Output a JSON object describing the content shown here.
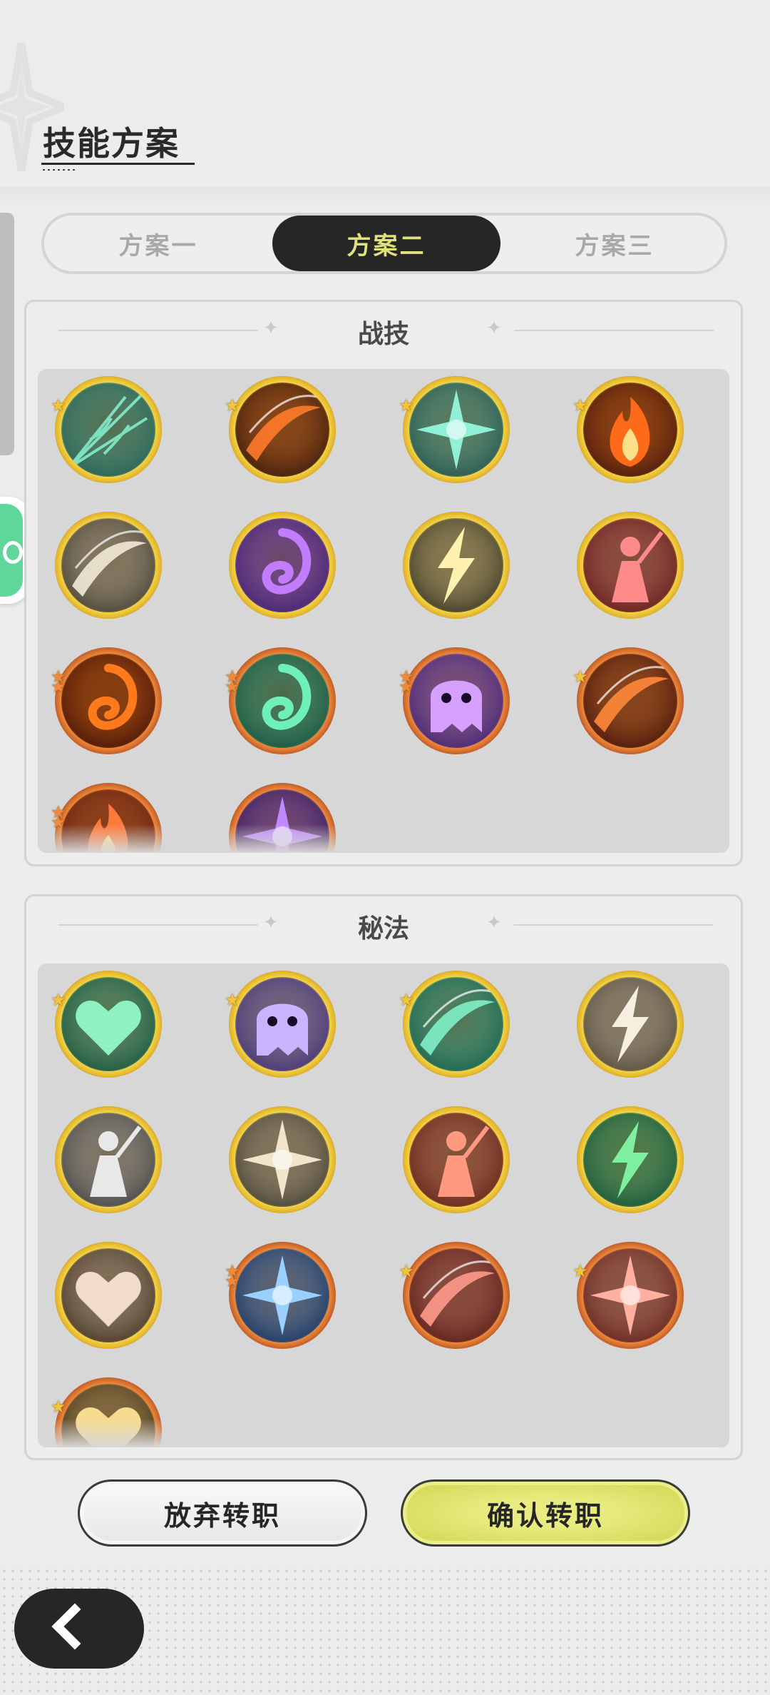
{
  "page": {
    "title": "技能方案"
  },
  "tabs": [
    {
      "label": "方案一",
      "active": false
    },
    {
      "label": "方案二",
      "active": true
    },
    {
      "label": "方案三",
      "active": false
    }
  ],
  "sections": [
    {
      "title": "战技",
      "skills": [
        {
          "icon": "spider-web-icon",
          "stars": 1,
          "tier": "gold"
        },
        {
          "icon": "fire-slash-icon",
          "stars": 1,
          "tier": "gold"
        },
        {
          "icon": "sword-burst-icon",
          "stars": 1,
          "tier": "gold"
        },
        {
          "icon": "flame-ring-icon",
          "stars": 1,
          "tier": "gold"
        },
        {
          "icon": "wind-slash-icon",
          "stars": 0,
          "tier": "gold"
        },
        {
          "icon": "purple-vortex-icon",
          "stars": 0,
          "tier": "gold"
        },
        {
          "icon": "lightning-strike-icon",
          "stars": 0,
          "tier": "gold"
        },
        {
          "icon": "warrior-blade-icon",
          "stars": 0,
          "tier": "gold"
        },
        {
          "icon": "fire-swirl-icon",
          "stars": 2,
          "tier": "orange"
        },
        {
          "icon": "green-tornado-icon",
          "stars": 2,
          "tier": "orange"
        },
        {
          "icon": "ghost-face-icon",
          "stars": 2,
          "tier": "orange"
        },
        {
          "icon": "flame-wave-icon",
          "stars": 1,
          "tier": "orange"
        },
        {
          "icon": "fire-figure-icon",
          "stars": 2,
          "tier": "orange"
        },
        {
          "icon": "purple-bloom-icon",
          "stars": 0,
          "tier": "orange"
        }
      ]
    },
    {
      "title": "秘法",
      "skills": [
        {
          "icon": "heal-heart-icon",
          "stars": 1,
          "tier": "gold"
        },
        {
          "icon": "shadow-beast-icon",
          "stars": 1,
          "tier": "gold"
        },
        {
          "icon": "green-blade-icon",
          "stars": 1,
          "tier": "gold"
        },
        {
          "icon": "crystal-shard-icon",
          "stars": 0,
          "tier": "gold"
        },
        {
          "icon": "dancing-figure-icon",
          "stars": 0,
          "tier": "gold"
        },
        {
          "icon": "leaf-emblem-icon",
          "stars": 0,
          "tier": "gold"
        },
        {
          "icon": "red-armor-icon",
          "stars": 0,
          "tier": "gold"
        },
        {
          "icon": "green-gem-icon",
          "stars": 0,
          "tier": "gold"
        },
        {
          "icon": "heart-shield-icon",
          "stars": 0,
          "tier": "gold"
        },
        {
          "icon": "blue-crown-icon",
          "stars": 2,
          "tier": "orange"
        },
        {
          "icon": "crimson-slash-icon",
          "stars": 1,
          "tier": "orange"
        },
        {
          "icon": "red-flower-icon",
          "stars": 1,
          "tier": "orange"
        },
        {
          "icon": "gold-shield-icon",
          "stars": 1,
          "tier": "orange"
        }
      ]
    }
  ],
  "buttons": {
    "abandon": "放弃转职",
    "confirm": "确认转职"
  },
  "icons": {
    "back": "back-arrow-icon",
    "side_chat": "chat-bubble-icon"
  },
  "colors": {
    "active_tab_bg": "#262626",
    "active_tab_text": "#dfe27a",
    "confirm_button": "#dde26a",
    "gold_ring": "#f0cf3f",
    "orange_ring": "#ef7f38",
    "side_tab_green": "#5fd69a"
  }
}
